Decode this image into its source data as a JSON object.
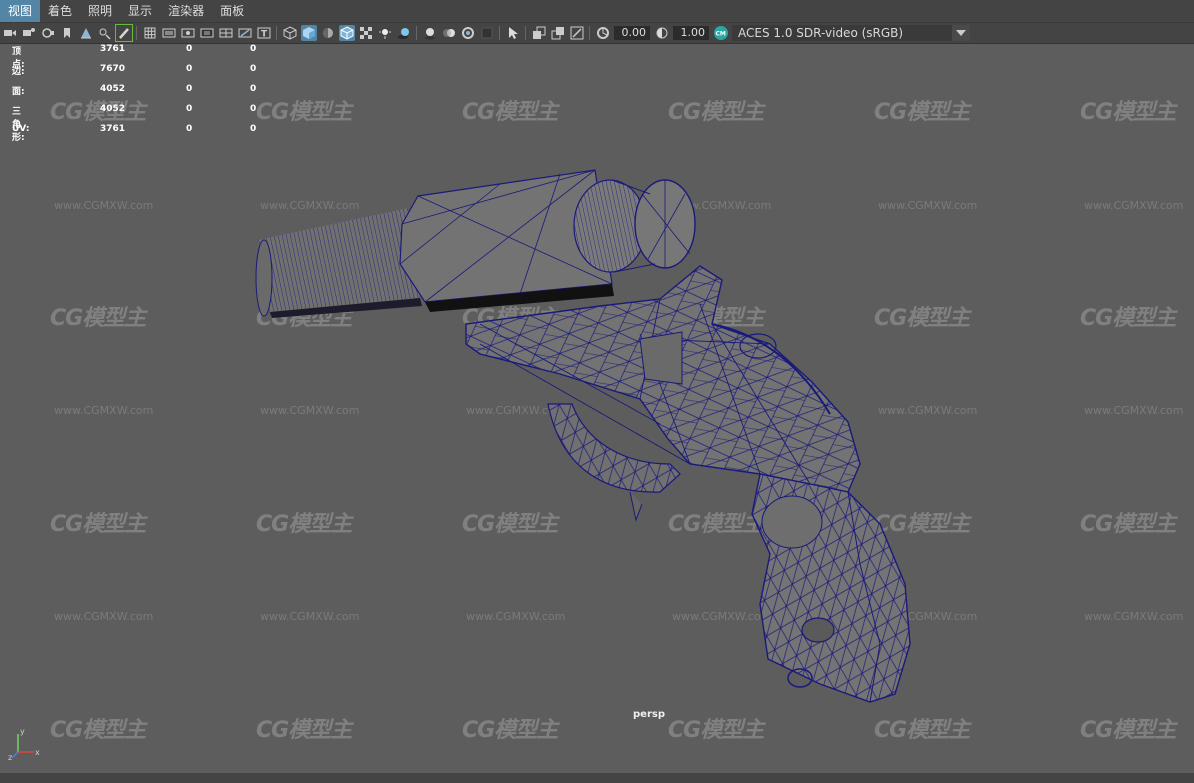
{
  "menu": [
    {
      "label": "视图",
      "active": true
    },
    {
      "label": "着色",
      "active": false
    },
    {
      "label": "照明",
      "active": false
    },
    {
      "label": "显示",
      "active": false
    },
    {
      "label": "渲染器",
      "active": false
    },
    {
      "label": "面板",
      "active": false
    }
  ],
  "toolbar": {
    "exposure_value": "0.00",
    "gamma_value": "1.00",
    "colorspace_label": "ACES 1.0 SDR-video (sRGB)"
  },
  "hud": {
    "rows": [
      {
        "label": "顶点:",
        "v1": "3761",
        "v2": "0",
        "v3": "0"
      },
      {
        "label": "边:",
        "v1": "7670",
        "v2": "0",
        "v3": "0"
      },
      {
        "label": "面:",
        "v1": "4052",
        "v2": "0",
        "v3": "0"
      },
      {
        "label": "三角形:",
        "v1": "4052",
        "v2": "0",
        "v3": "0"
      },
      {
        "label": "UV:",
        "v1": "3761",
        "v2": "0",
        "v3": "0"
      }
    ]
  },
  "viewport": {
    "camera_label": "persp",
    "watermark_logo": "CG模型主",
    "watermark_url": "www.CGMXW.com"
  },
  "colors": {
    "menu_active": "#5285a6",
    "viewport_bg": "#5d5d5d",
    "wireframe": "#1a1a7a",
    "mesh_fill": "#6e6e6e"
  }
}
